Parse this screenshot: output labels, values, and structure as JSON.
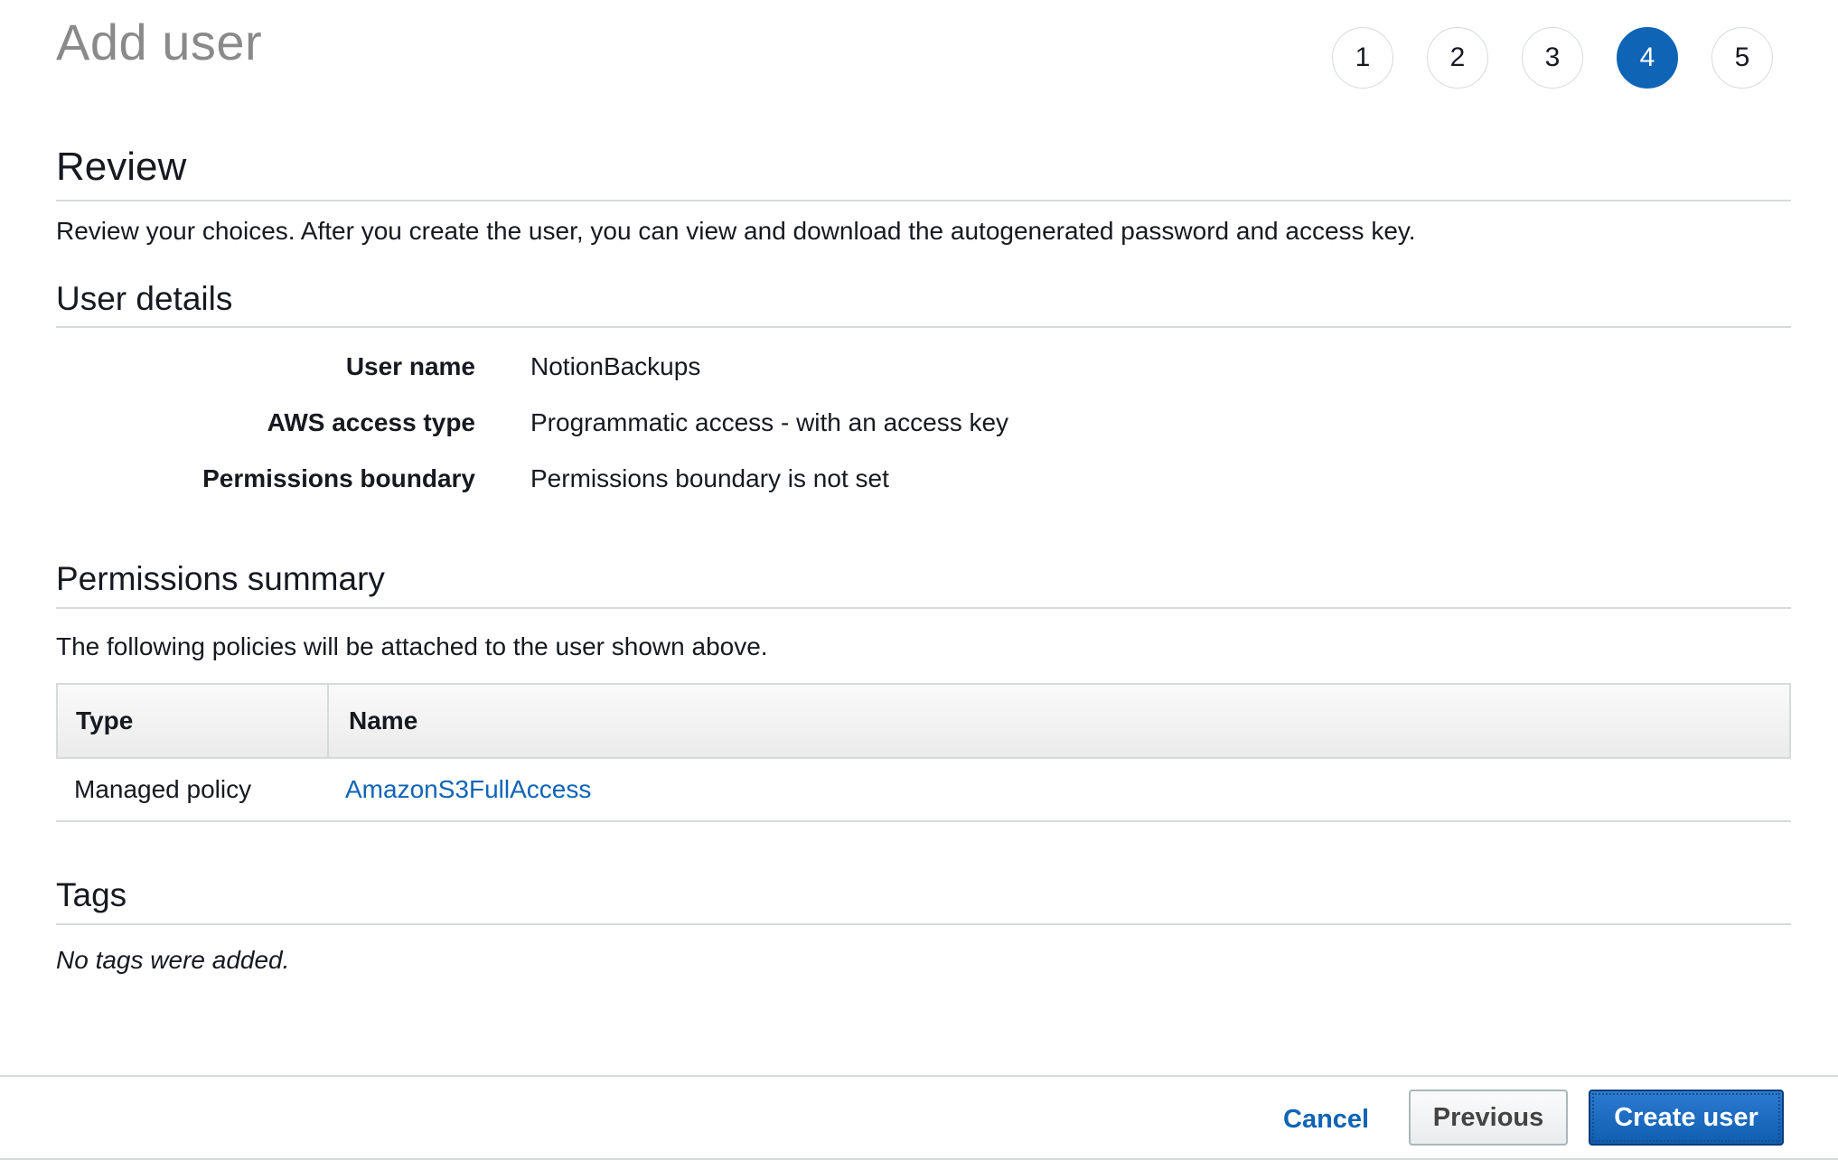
{
  "header": {
    "title": "Add user"
  },
  "wizard": {
    "steps": [
      "1",
      "2",
      "3",
      "4",
      "5"
    ],
    "active_step": "4",
    "active_color": "#0f64b6"
  },
  "review": {
    "title": "Review",
    "description": "Review your choices. After you create the user, you can view and download the autogenerated password and access key."
  },
  "user_details": {
    "title": "User details",
    "rows": [
      {
        "label": "User name",
        "value": "NotionBackups"
      },
      {
        "label": "AWS access type",
        "value": "Programmatic access - with an access key"
      },
      {
        "label": "Permissions boundary",
        "value": "Permissions boundary is not set"
      }
    ]
  },
  "permissions_summary": {
    "title": "Permissions summary",
    "description": "The following policies will be attached to the user shown above.",
    "columns": [
      "Type",
      "Name"
    ],
    "rows": [
      {
        "type": "Managed policy",
        "name": "AmazonS3FullAccess"
      }
    ]
  },
  "tags": {
    "title": "Tags",
    "empty_note": "No tags were added."
  },
  "footer": {
    "cancel_label": "Cancel",
    "previous_label": "Previous",
    "create_label": "Create user"
  }
}
